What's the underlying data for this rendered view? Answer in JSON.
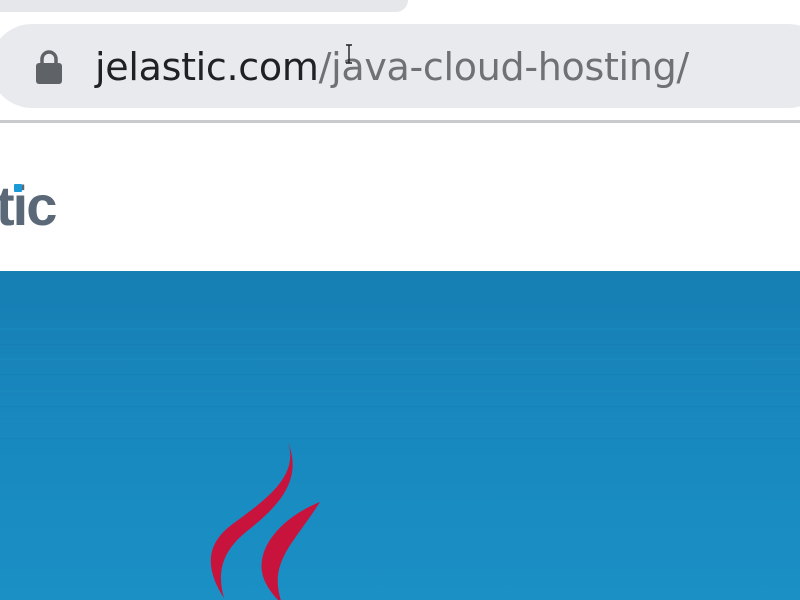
{
  "browser": {
    "url_host": "jelastic.com",
    "url_path": "/java-cloud-hosting/",
    "icons": {
      "lock": "lock-icon",
      "cursor": "text-cursor-icon"
    }
  },
  "site": {
    "logo_text_visible": "tic",
    "hero_logo_icon": "java-logo-icon"
  },
  "colors": {
    "omnibox_bg": "#e8eaed",
    "url_host": "#202124",
    "url_path": "#6f7175",
    "logo_gray": "#5b6877",
    "logo_accent": "#1a9ad6",
    "hero_blue": "#1887bd",
    "java_red": "#c8143c"
  }
}
